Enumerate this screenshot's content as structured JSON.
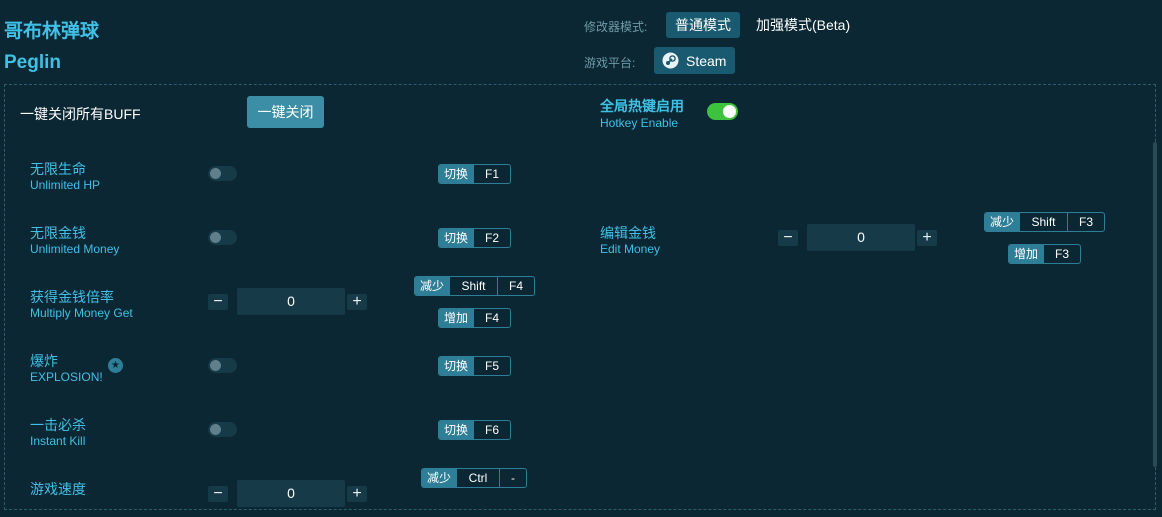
{
  "header": {
    "title_cn": "哥布林弹球",
    "title_en": "Peglin",
    "mode_label": "修改器模式:",
    "mode_normal": "普通模式",
    "mode_enhanced": "加强模式(Beta)",
    "platform_label": "游戏平台:",
    "platform_name": "Steam"
  },
  "toolbar": {
    "close_all_label": "一键关闭所有BUFF",
    "close_all_button": "一键关闭",
    "hotkey_cn": "全局热键启用",
    "hotkey_en": "Hotkey Enable",
    "hotkey_enabled": true
  },
  "features": {
    "hp": {
      "cn": "无限生命",
      "en": "Unlimited HP",
      "enabled": false,
      "action": "切换",
      "key": "F1"
    },
    "money": {
      "cn": "无限金钱",
      "en": "Unlimited Money",
      "enabled": false,
      "action": "切换",
      "key": "F2"
    },
    "multiply": {
      "cn": "获得金钱倍率",
      "en": "Multiply Money Get",
      "value": "0",
      "dec_action": "减少",
      "dec_mod": "Shift",
      "dec_key": "F4",
      "inc_action": "增加",
      "inc_key": "F4"
    },
    "explosion": {
      "cn": "爆炸",
      "en": "EXPLOSION!",
      "enabled": false,
      "action": "切换",
      "key": "F5",
      "star_icon": "star-icon"
    },
    "kill": {
      "cn": "一击必杀",
      "en": "Instant Kill",
      "enabled": false,
      "action": "切换",
      "key": "F6"
    },
    "speed": {
      "cn": "游戏速度",
      "value": "0",
      "dec_action": "减少",
      "dec_mod": "Ctrl",
      "dec_key": "-"
    },
    "edit_money": {
      "cn": "编辑金钱",
      "en": "Edit Money",
      "value": "0",
      "dec_action": "减少",
      "dec_mod": "Shift",
      "dec_key": "F3",
      "inc_action": "增加",
      "inc_key": "F3"
    }
  },
  "stepper": {
    "minus": "−",
    "plus": "+"
  },
  "colors": {
    "background": "#0b2733",
    "accent": "#3fc0e6",
    "toggle_on": "#3cc23c",
    "button": "#3b8ea6"
  }
}
